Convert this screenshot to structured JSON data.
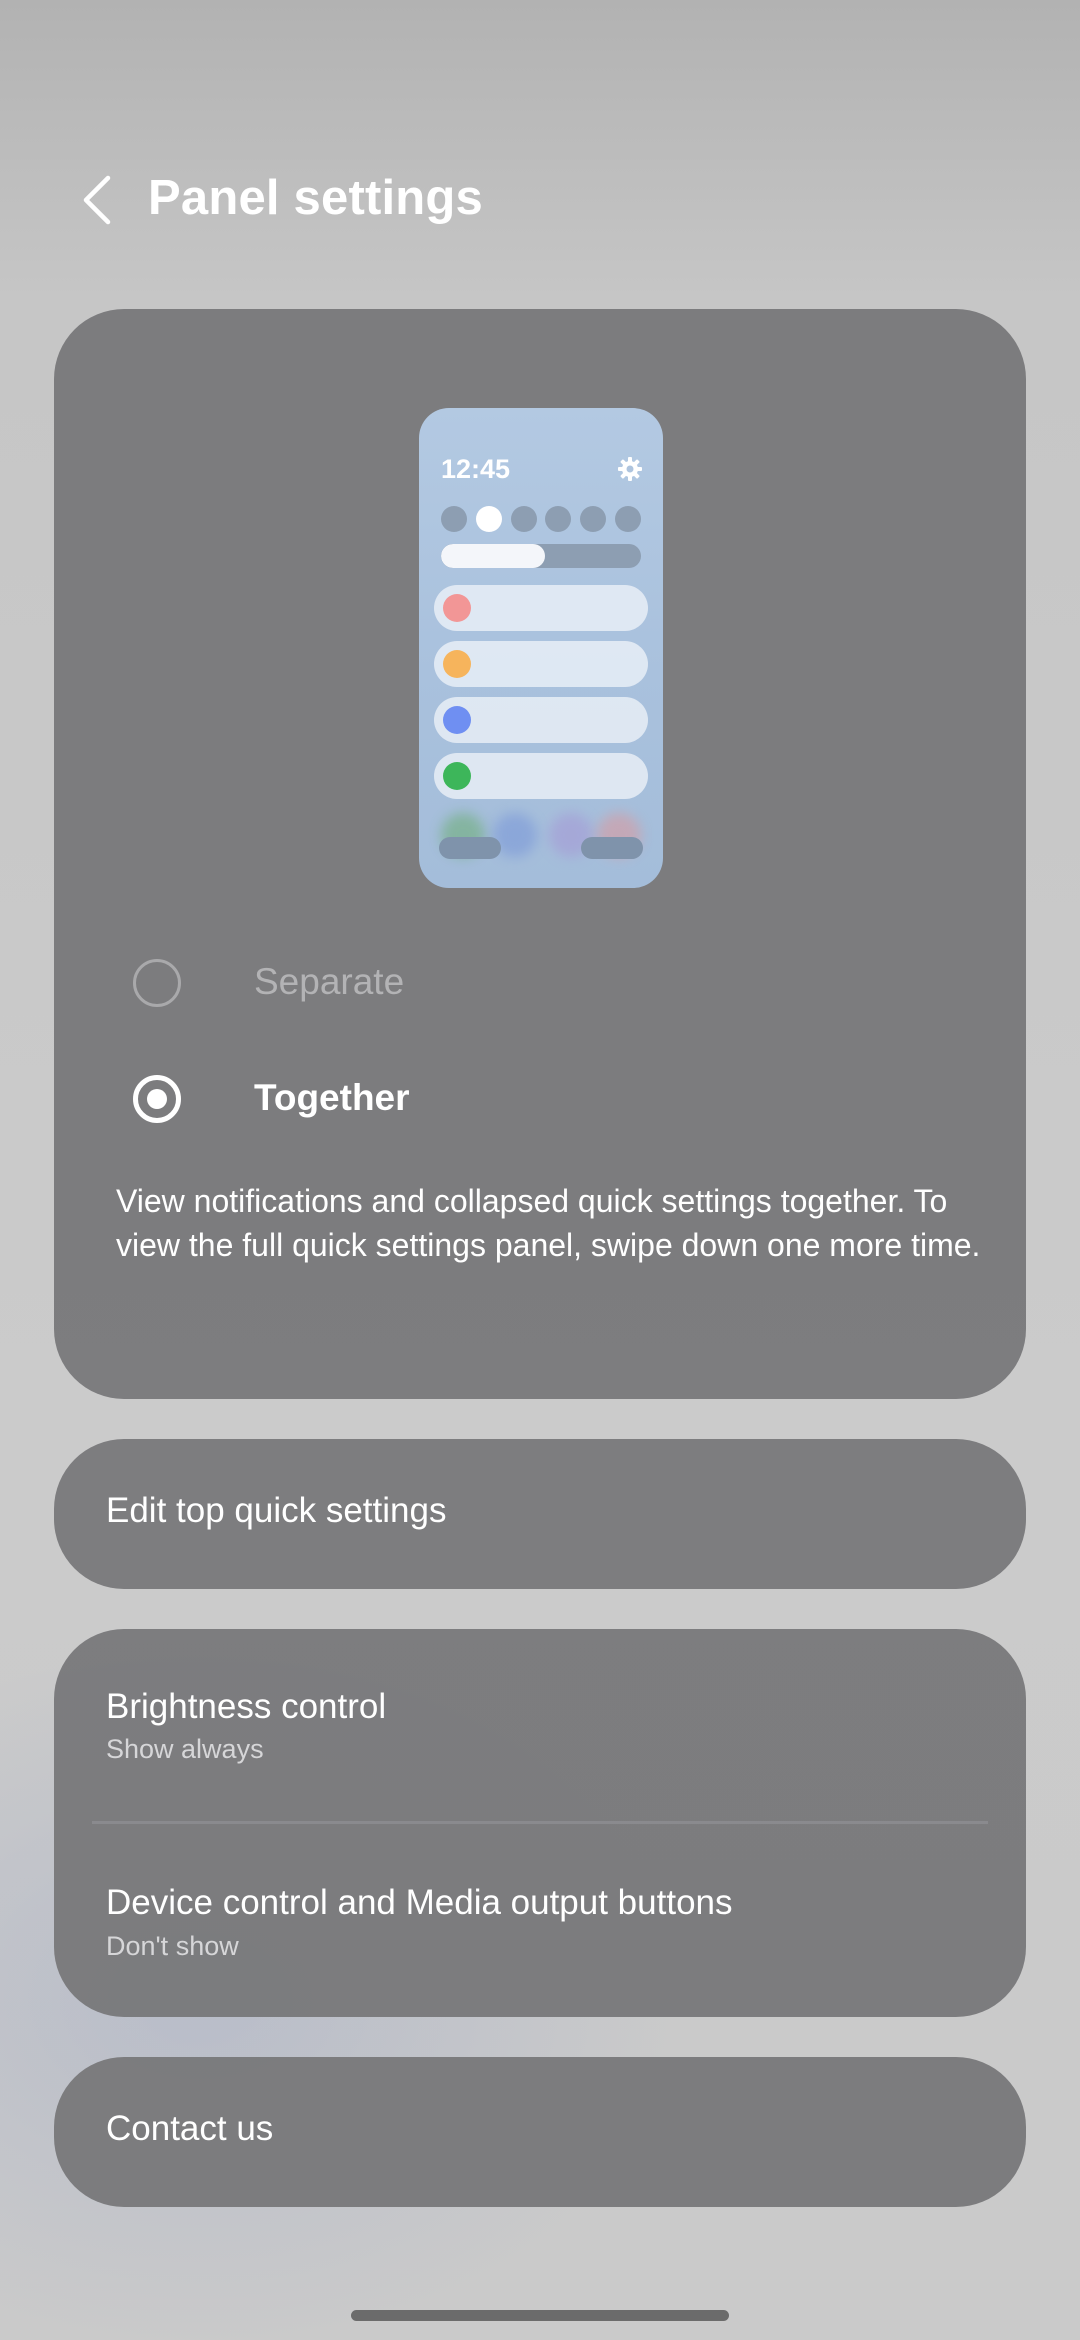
{
  "header": {
    "back_icon": "chevron-left-icon",
    "title": "Panel settings"
  },
  "layout_card": {
    "preview": {
      "time": "12:45",
      "gear_icon": "gear-icon",
      "row_colors": [
        "#f29696",
        "#f6b45c",
        "#6f8ff2",
        "#3db65a"
      ],
      "brightness_level": 0.52
    },
    "options": [
      {
        "label": "Separate",
        "selected": false
      },
      {
        "label": "Together",
        "selected": true
      }
    ],
    "description": "View notifications and collapsed quick settings together. To view the full quick settings panel, swipe down one more time."
  },
  "edit_card": {
    "title": "Edit top quick settings"
  },
  "brightness_card": {
    "items": [
      {
        "title": "Brightness control",
        "subtitle": "Show always"
      },
      {
        "title": "Device control and Media output buttons",
        "subtitle": "Don't show"
      }
    ]
  },
  "contact_card": {
    "title": "Contact us"
  },
  "colors": {
    "card": "#767678",
    "accent_white": "#ffffff"
  }
}
